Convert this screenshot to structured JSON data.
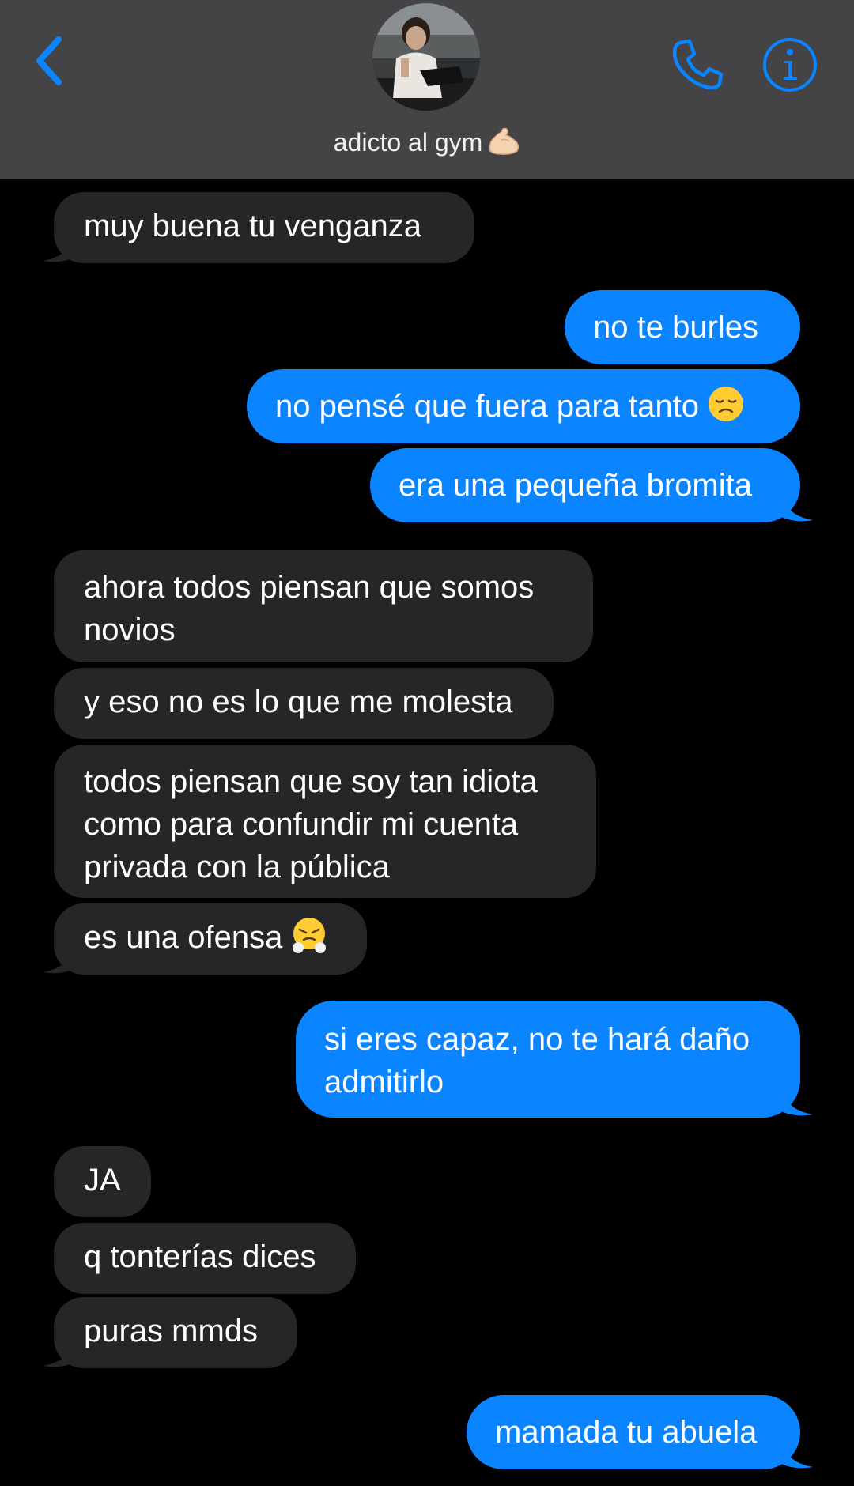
{
  "header": {
    "contact_name": "adicto al gym",
    "contact_emoji": "flexed-biceps-emoji",
    "back_icon": "chevron-left-icon",
    "call_icon": "phone-icon",
    "info_icon": "info-icon",
    "accent_color": "#0a84ff"
  },
  "messages": [
    {
      "direction": "incoming",
      "text": "muy buena tu venganza"
    },
    {
      "direction": "outgoing",
      "text": "no te burles"
    },
    {
      "direction": "outgoing",
      "text": "no pensé que fuera para tanto",
      "emoji": "disappointed-face-emoji"
    },
    {
      "direction": "outgoing",
      "text": "era una pequeña bromita"
    },
    {
      "direction": "incoming",
      "text": "ahora todos piensan que somos novios"
    },
    {
      "direction": "incoming",
      "text": "y eso no es lo que me molesta"
    },
    {
      "direction": "incoming",
      "text": "todos piensan que soy tan idiota como para confundir mi cuenta privada con la pública"
    },
    {
      "direction": "incoming",
      "text": "es una ofensa",
      "emoji": "face-with-steam-emoji"
    },
    {
      "direction": "outgoing",
      "text": "si eres capaz, no te hará daño admitirlo"
    },
    {
      "direction": "incoming",
      "text": "JA"
    },
    {
      "direction": "incoming",
      "text": "q tonterías dices"
    },
    {
      "direction": "incoming",
      "text": "puras mmds"
    },
    {
      "direction": "outgoing",
      "text": "mamada tu abuela"
    }
  ],
  "colors": {
    "incoming_bubble": "#262629",
    "outgoing_bubble": "#0a84ff",
    "header_bg": "#444446",
    "background": "#000000"
  }
}
